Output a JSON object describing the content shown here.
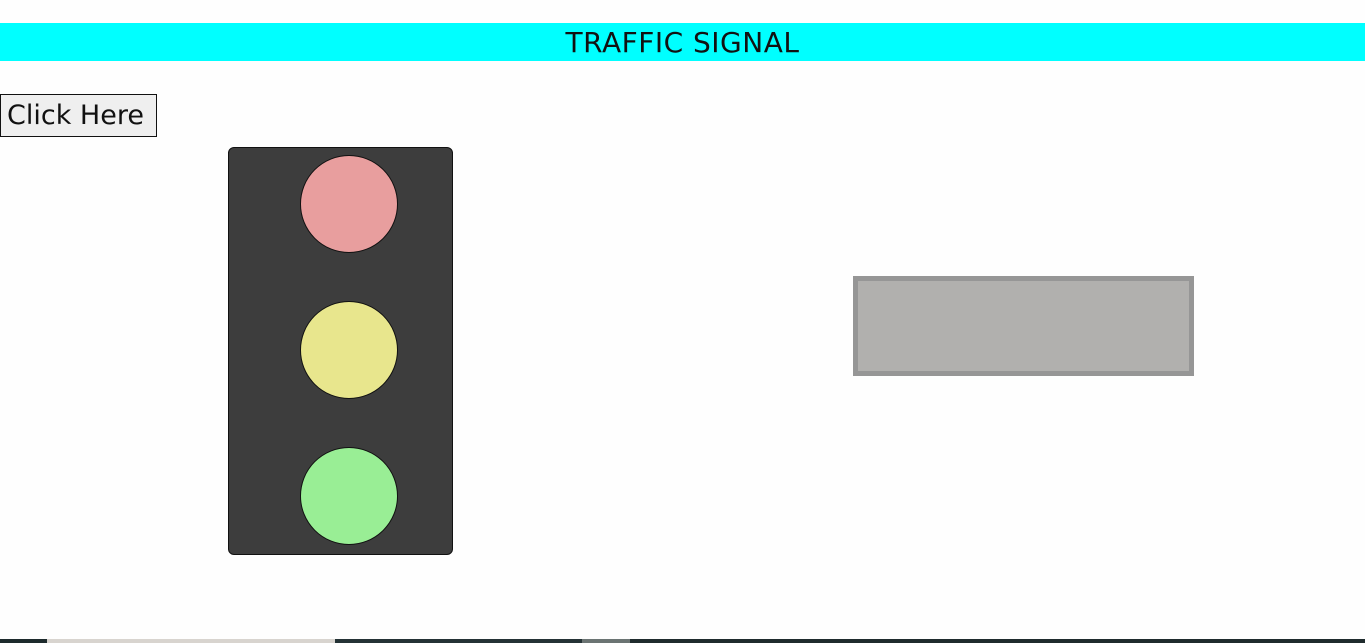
{
  "header": {
    "title": "TRAFFIC SIGNAL",
    "background": "#00ffff"
  },
  "controls": {
    "button_label": "Click Here"
  },
  "signal": {
    "lights": [
      {
        "name": "red",
        "color": "#e89e9e",
        "on": false
      },
      {
        "name": "yellow",
        "color": "#e8e68d",
        "on": false
      },
      {
        "name": "green",
        "color": "#99ee95",
        "on": false
      }
    ],
    "housing_color": "#3d3d3d"
  },
  "display": {
    "text": "",
    "background": "#b1b0ae"
  }
}
